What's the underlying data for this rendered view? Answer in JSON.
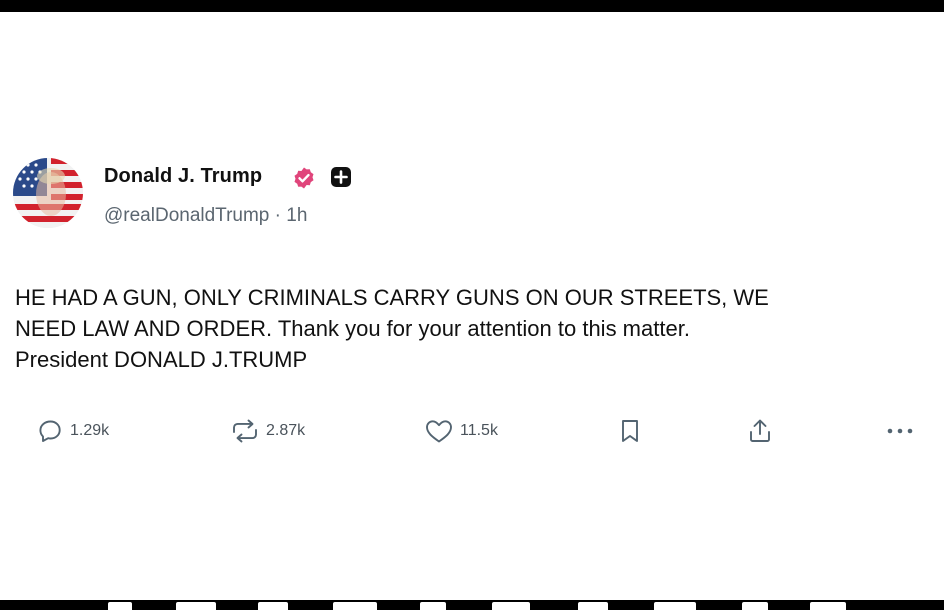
{
  "post": {
    "author": {
      "display_name": "Donald J. Trump",
      "handle": "@realDonaldTrump",
      "separator": "·",
      "time_ago": "1h"
    },
    "text_lines": [
      "HE HAD A GUN, ONLY CRIMINALS CARRY GUNS ON OUR STREETS, WE",
      "NEED LAW AND ORDER. Thank you for your attention to this matter.",
      "President DONALD J.TRUMP"
    ],
    "actions": {
      "replies": "1.29k",
      "reposts": "2.87k",
      "likes": "11.5k"
    }
  },
  "colors": {
    "verified_badge": "#e0457b",
    "affiliate_badge": "#111111",
    "icon_gray": "#536471",
    "text": "#111111",
    "muted_text": "#5b6670"
  },
  "icons": [
    "avatar-image",
    "verified-badge-icon",
    "affiliate-badge-icon",
    "reply-icon",
    "repost-icon",
    "like-icon",
    "bookmark-icon",
    "share-icon",
    "more-icon"
  ]
}
